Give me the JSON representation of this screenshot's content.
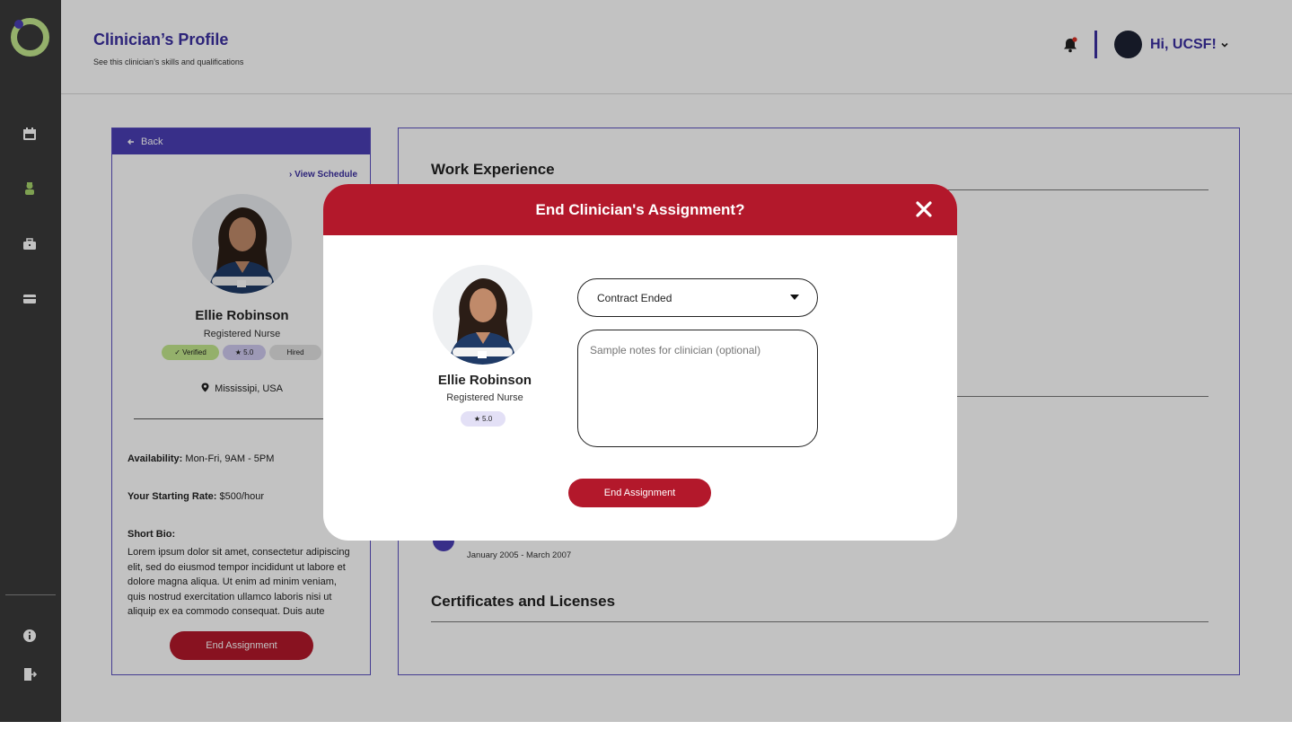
{
  "header": {
    "title": "Clinician’s Profile",
    "subtitle": "See this clinician’s skills and qualifications",
    "greeting": "Hi, UCSF!"
  },
  "profile": {
    "back_label": "Back",
    "view_schedule": "View Schedule",
    "name": "Ellie Robinson",
    "role": "Registered Nurse",
    "badges": {
      "verified": "Verified",
      "rating": "5.0",
      "hired": "Hired"
    },
    "location": "Mississipi, USA",
    "availability_label": "Availability:",
    "availability_value": "Mon-Fri, 9AM - 5PM",
    "rate_label": "Your Starting Rate:",
    "rate_value": "$500/hour",
    "bio_label": "Short Bio:",
    "bio_text": "Lorem ipsum dolor sit amet, consectetur adipiscing elit, sed do eiusmod tempor incididunt ut labore et dolore magna aliqua. Ut enim ad minim veniam, quis nostrud exercitation ullamco laboris nisi ut aliquip ex ea commodo consequat. Duis aute",
    "end_button": "End Assignment"
  },
  "details": {
    "work_experience": "Work Experience",
    "job_dates": "January 2005 - March 2007",
    "certificates": "Certificates and Licenses"
  },
  "modal": {
    "title": "End Clinician's Assignment?",
    "name": "Ellie Robinson",
    "role": "Registered Nurse",
    "rating": "5.0",
    "reason_selected": "Contract Ended",
    "notes_placeholder": "Sample notes for clinician (optional)",
    "submit": "End Assignment"
  },
  "colors": {
    "brand": "#4a3fb5",
    "danger": "#b3182b",
    "sidebar": "#3a3a3a",
    "logo_green": "#c3e88d"
  },
  "icons": [
    "logo",
    "calendar-icon",
    "nurse-icon",
    "briefcase-icon",
    "credit-card-icon",
    "info-icon",
    "logout-icon",
    "bell-icon",
    "chevron-down-icon",
    "arrow-left-icon",
    "chevron-right-icon",
    "location-pin-icon",
    "star-icon",
    "check-icon",
    "close-icon",
    "caret-down-icon"
  ]
}
